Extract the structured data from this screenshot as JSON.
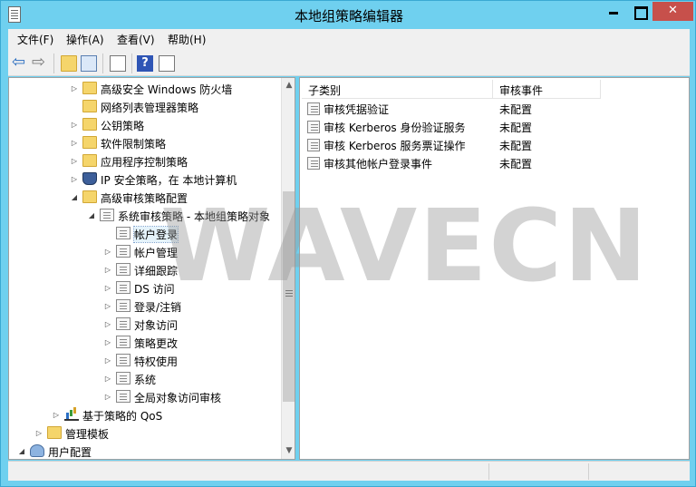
{
  "window": {
    "title": "本地组策略编辑器",
    "close_glyph": "✕"
  },
  "menu": {
    "items": [
      {
        "label": "文件(F)"
      },
      {
        "label": "操作(A)"
      },
      {
        "label": "查看(V)"
      },
      {
        "label": "帮助(H)"
      }
    ]
  },
  "toolbar": {
    "back_glyph": "⇦",
    "forward_glyph": "⇨",
    "help_glyph": "?"
  },
  "tree": {
    "items": [
      {
        "label": "高级安全 Windows 防火墙",
        "icon": "folder",
        "expander": "collapsed"
      },
      {
        "label": "网络列表管理器策略",
        "icon": "folder",
        "expander": "none"
      },
      {
        "label": "公钥策略",
        "icon": "folder",
        "expander": "collapsed"
      },
      {
        "label": "软件限制策略",
        "icon": "folder",
        "expander": "collapsed"
      },
      {
        "label": "应用程序控制策略",
        "icon": "folder",
        "expander": "collapsed"
      },
      {
        "label": "IP 安全策略，在 本地计算机",
        "icon": "shield",
        "expander": "collapsed"
      },
      {
        "label": "高级审核策略配置",
        "icon": "folder",
        "expander": "expanded"
      },
      {
        "label": "系统审核策略 - 本地组策略对象",
        "icon": "policy-container",
        "expander": "expanded"
      },
      {
        "label": "帐户登录",
        "icon": "policy",
        "expander": "none",
        "selected": true
      },
      {
        "label": "帐户管理",
        "icon": "policy",
        "expander": "collapsed"
      },
      {
        "label": "详细跟踪",
        "icon": "policy",
        "expander": "collapsed"
      },
      {
        "label": "DS 访问",
        "icon": "policy",
        "expander": "collapsed"
      },
      {
        "label": "登录/注销",
        "icon": "policy",
        "expander": "collapsed"
      },
      {
        "label": "对象访问",
        "icon": "policy",
        "expander": "collapsed"
      },
      {
        "label": "策略更改",
        "icon": "policy",
        "expander": "collapsed"
      },
      {
        "label": "特权使用",
        "icon": "policy",
        "expander": "collapsed"
      },
      {
        "label": "系统",
        "icon": "policy",
        "expander": "collapsed"
      },
      {
        "label": "全局对象访问审核",
        "icon": "policy",
        "expander": "collapsed"
      },
      {
        "label": "基于策略的 QoS",
        "icon": "chart",
        "expander": "collapsed"
      },
      {
        "label": "管理模板",
        "icon": "folder",
        "expander": "collapsed"
      },
      {
        "label": "用户配置",
        "icon": "user",
        "expander": "expanded"
      }
    ]
  },
  "list": {
    "columns": [
      "子类别",
      "审核事件"
    ],
    "rows": [
      {
        "name": "审核凭据验证",
        "status": "未配置"
      },
      {
        "name": "审核 Kerberos 身份验证服务",
        "status": "未配置"
      },
      {
        "name": "审核 Kerberos 服务票证操作",
        "status": "未配置"
      },
      {
        "name": "审核其他帐户登录事件",
        "status": "未配置"
      }
    ]
  },
  "watermark": "WAVECN",
  "glyphs": {
    "collapsed": "▷",
    "expanded": "◢",
    "scroll_up": "▲",
    "scroll_down": "▼"
  }
}
